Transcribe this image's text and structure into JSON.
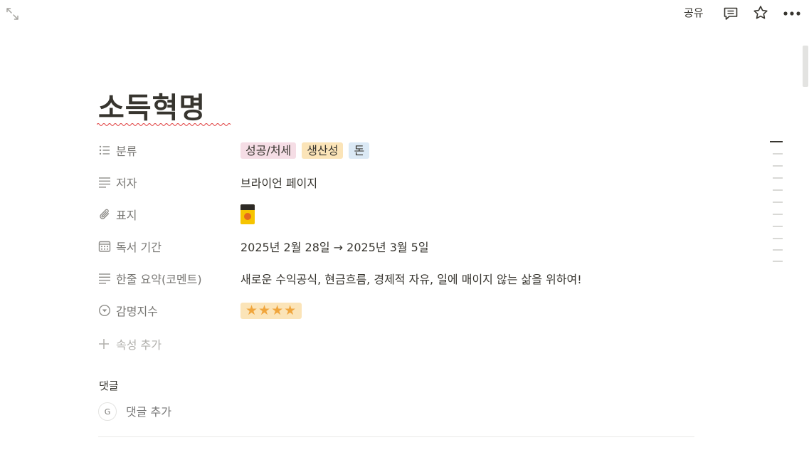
{
  "topbar": {
    "share_label": "공유",
    "icons": [
      "expand-icon",
      "comment-icon",
      "star-icon",
      "more-icon"
    ]
  },
  "page": {
    "title": "소득혁명"
  },
  "properties": [
    {
      "name": "분류",
      "icon": "list-icon",
      "tags": [
        {
          "label": "성공/처세",
          "color": "#f5dde5"
        },
        {
          "label": "생산성",
          "color": "#fbe4b8"
        },
        {
          "label": "돈",
          "color": "#dbe9f5"
        }
      ]
    },
    {
      "name": "저자",
      "icon": "text-lines-icon",
      "value": "브라이언 페이지"
    },
    {
      "name": "표지",
      "icon": "paperclip-icon",
      "value_type": "book-cover-thumbnail"
    },
    {
      "name": "독서 기간",
      "icon": "calendar-icon",
      "value": "2025년 2월 28일 → 2025년 3월 5일"
    },
    {
      "name": "한줄 요약(코멘트)",
      "icon": "text-lines-icon",
      "value": "새로운 수익공식, 현금흐름, 경제적 자유, 일에 매이지 않는 삶을 위하여!"
    },
    {
      "name": "감명지수",
      "icon": "select-icon",
      "rating": 4,
      "rating_display": "★★★★",
      "rating_color": "#fbe4b8"
    }
  ],
  "add_property_label": "속성 추가",
  "comments": {
    "heading": "댓글",
    "avatar_initial": "G",
    "placeholder": "댓글 추가"
  },
  "colors": {
    "text": "#37352f",
    "muted": "#787774",
    "placeholder": "#9b9a97"
  },
  "toc_item_count": 11
}
